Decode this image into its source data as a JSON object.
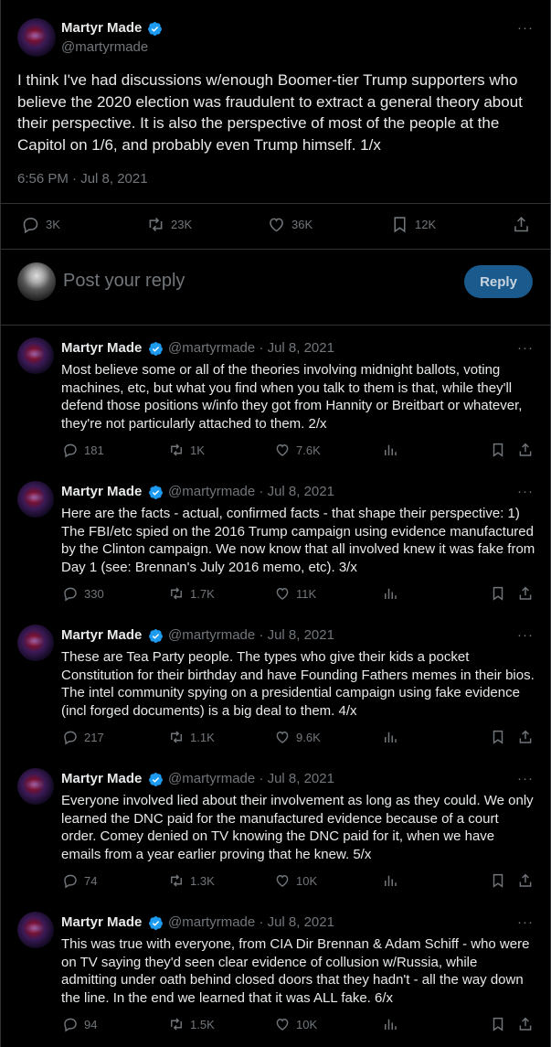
{
  "main_tweet": {
    "author_name": "Martyr Made",
    "handle": "@martyrmade",
    "more": "···",
    "text": "I think I've had discussions w/enough Boomer-tier Trump supporters who believe the 2020 election was fraudulent to extract a general theory about their perspective. It is also the perspective of most of the people at the Capitol on 1/6, and probably even Trump himself. 1/x",
    "timestamp": "6:56 PM · Jul 8, 2021",
    "replies": "3K",
    "reposts": "23K",
    "likes": "36K",
    "bookmarks": "12K"
  },
  "reply_box": {
    "placeholder": "Post your reply",
    "button_label": "Reply"
  },
  "thread": [
    {
      "author_name": "Martyr Made",
      "meta": "@martyrmade · Jul 8, 2021",
      "text": "Most believe some or all of the theories involving midnight ballots, voting machines, etc, but what you find when you talk to them is that, while they'll defend those positions w/info they got from Hannity or Breitbart or whatever, they're not particularly attached to them. 2/x",
      "replies": "181",
      "reposts": "1K",
      "likes": "7.6K"
    },
    {
      "author_name": "Martyr Made",
      "meta": "@martyrmade · Jul 8, 2021",
      "text": "Here are the facts - actual, confirmed facts - that shape their perspective: 1) The FBI/etc spied on the 2016 Trump campaign using evidence manufactured by the Clinton campaign. We now know that all involved knew it was fake from Day 1 (see: Brennan's July 2016 memo, etc). 3/x",
      "replies": "330",
      "reposts": "1.7K",
      "likes": "11K"
    },
    {
      "author_name": "Martyr Made",
      "meta": "@martyrmade · Jul 8, 2021",
      "text": "These are Tea Party people. The types who give their kids a pocket Constitution for their birthday and have Founding Fathers memes in their bios. The intel community spying on a presidential campaign using fake evidence (incl forged documents) is a big deal to them. 4/x",
      "replies": "217",
      "reposts": "1.1K",
      "likes": "9.6K"
    },
    {
      "author_name": "Martyr Made",
      "meta": "@martyrmade · Jul 8, 2021",
      "text": "Everyone involved lied about their involvement as long as they could. We only learned the DNC paid for the manufactured evidence because of a court order. Comey denied on TV knowing the DNC paid for it, when we have emails from a year earlier proving that he knew. 5/x",
      "replies": "74",
      "reposts": "1.3K",
      "likes": "10K"
    },
    {
      "author_name": "Martyr Made",
      "meta": "@martyrmade · Jul 8, 2021",
      "text": "This was true with everyone, from CIA Dir Brennan & Adam Schiff - who were on TV saying they'd seen clear evidence of collusion w/Russia, while admitting under oath behind closed doors that they hadn't - all the way down the line. In the end we learned that it was ALL fake. 6/x",
      "replies": "94",
      "reposts": "1.5K",
      "likes": "10K"
    }
  ],
  "colors": {
    "background": "#000000",
    "text": "#e7e9ea",
    "muted": "#71767b",
    "border": "#2f3336",
    "verified": "#1d9bf0",
    "reply_button": "#1a5a8c"
  }
}
